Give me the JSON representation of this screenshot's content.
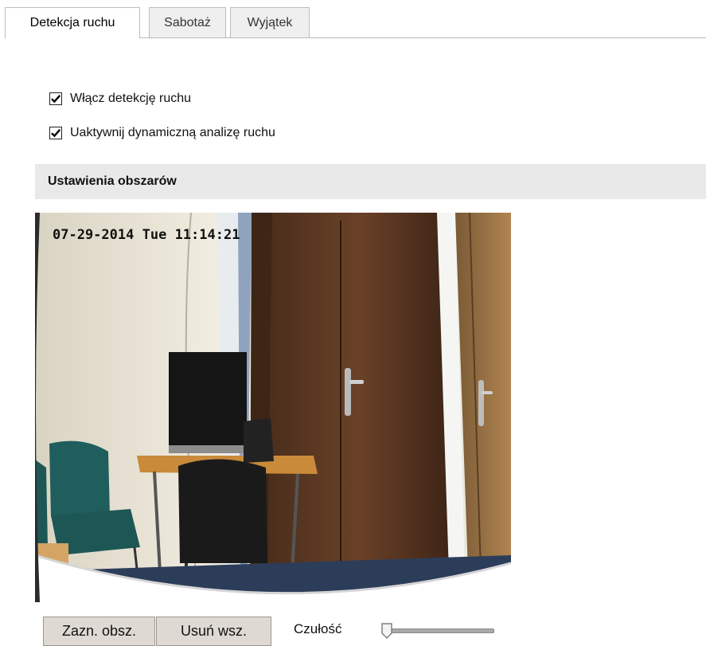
{
  "tabs": [
    {
      "label": "Detekcja ruchu",
      "active": true
    },
    {
      "label": "Sabotaż",
      "active": false
    },
    {
      "label": "Wyjątek",
      "active": false
    }
  ],
  "options": {
    "enable_motion": {
      "label": "Włącz detekcję ruchu",
      "checked": true
    },
    "dynamic_analysis": {
      "label": "Uaktywnij dynamiczną analizę ruchu",
      "checked": true
    }
  },
  "area_settings": {
    "title": "Ustawienia obszarów",
    "video": {
      "osd_date": "07-29-2014",
      "osd_day": "Tue",
      "osd_time": "11:14:21"
    }
  },
  "controls": {
    "draw_area_label": "Zazn. obsz.",
    "clear_all_label": "Usuń wsz.",
    "sensitivity_label": "Czułość",
    "sensitivity_value": 0
  },
  "colors": {
    "tab_border": "#bdbdbd",
    "section_bg": "#e9e9e9",
    "button_bg": "#dedad3"
  },
  "icons": {
    "checkbox": "checkmark-icon",
    "slider": "slider-thumb-icon"
  }
}
